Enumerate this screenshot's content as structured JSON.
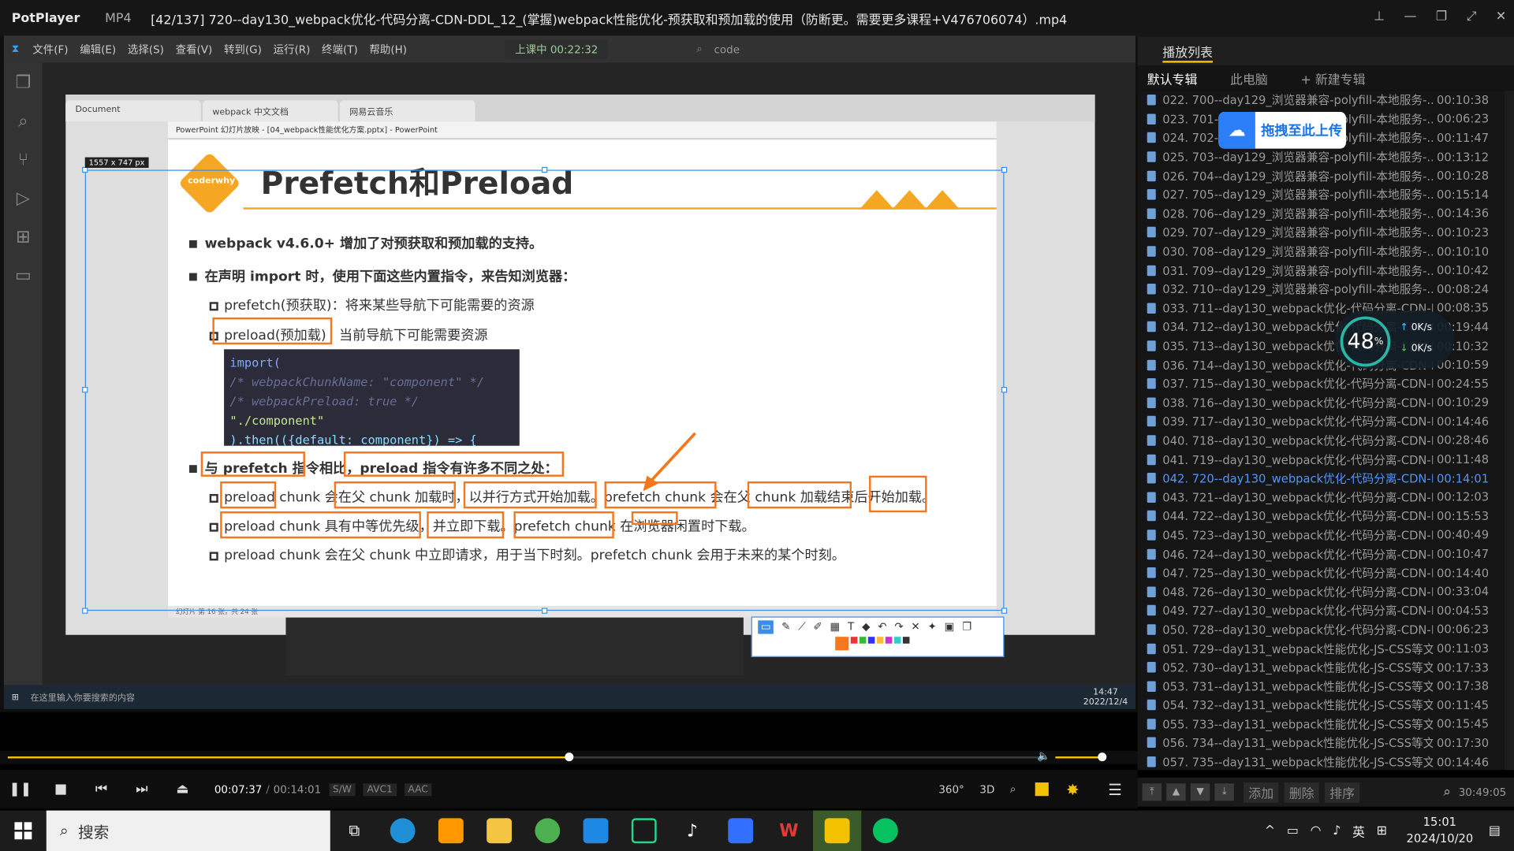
{
  "app": {
    "name": "PotPlayer",
    "format": "MP4",
    "title": "[42/137] 720--day130_webpack优化-代码分离-CDN-DDL_12_(掌握)webpack性能优化-预获取和预加载的使用（防断更。需要更多课程+V476706074）.mp4"
  },
  "video": {
    "vscode_menu": [
      "文件(F)",
      "编辑(E)",
      "选择(S)",
      "查看(V)",
      "转到(G)",
      "运行(R)",
      "终端(T)",
      "帮助(H)"
    ],
    "remote_status": "上课中 00:22:32",
    "search_text": "code",
    "browser_tabs": [
      "Document",
      "webpack 中文文档",
      "网易云音乐"
    ],
    "ppt_title": "PowerPoint 幻灯片放映 - [04_webpack性能优化方案.pptx] - PowerPoint",
    "size_label": "1557 x 747  px",
    "slide_status": "幻灯片 第 16 张，共 24 张",
    "slide": {
      "title": "Prefetch和Preload",
      "logo": "coderwhy",
      "bullet1": "webpack v4.6.0+ 增加了对预获取和预加载的支持。",
      "bullet2": "在声明 import 时，使用下面这些内置指令，来告知浏览器：",
      "sub1": "prefetch(预获取)：将来某些导航下可能需要的资源",
      "sub2_a": "preload(预加载)",
      "sub2_b": "当前导航下可能需要资源",
      "code": [
        "import(",
        "  /* webpackChunkName: \"component\" */",
        "  /* webpackPreload: true */",
        "  \"./component\"",
        ").then(({default: component}) => {"
      ],
      "bullet3_a": "与 prefetch 指令相比，",
      "bullet3_b": "preload 指令有许多不同之处：",
      "d1": "preload chunk 会在父 chunk 加载时，以并行方式开始加载。prefetch chunk 会在父 chunk 加载结束后开始加载。",
      "d2": "preload chunk 具有中等优先级，并立即下载。prefetch chunk 在浏览器闲置时下载。",
      "d3": "preload chunk 会在父 chunk 中立即请求，用于当下时刻。prefetch chunk 会用于未来的某个时刻。"
    },
    "inner_taskbar_search": "在这里输入你要搜索的内容",
    "inner_clock": "14:47",
    "inner_date": "2022/12/4"
  },
  "playlist": {
    "header": "播放列表",
    "tabs": [
      "默认专辑",
      "此电脑",
      "+ 新建专辑"
    ],
    "items": [
      [
        "022. 700--day129_浏览器兼容-polyfill-本地服务-...",
        "00:10:38"
      ],
      [
        "023. 701--day129_浏览器兼容-polyfill-本地服务-...",
        "00:06:23"
      ],
      [
        "024. 702--day129_浏览器兼容-polyfill-本地服务-...",
        "00:11:47"
      ],
      [
        "025. 703--day129_浏览器兼容-polyfill-本地服务-...",
        "00:13:12"
      ],
      [
        "026. 704--day129_浏览器兼容-polyfill-本地服务-...",
        "00:10:28"
      ],
      [
        "027. 705--day129_浏览器兼容-polyfill-本地服务-...",
        "00:15:14"
      ],
      [
        "028. 706--day129_浏览器兼容-polyfill-本地服务-...",
        "00:14:36"
      ],
      [
        "029. 707--day129_浏览器兼容-polyfill-本地服务-...",
        "00:10:23"
      ],
      [
        "030. 708--day129_浏览器兼容-polyfill-本地服务-...",
        "00:10:10"
      ],
      [
        "031. 709--day129_浏览器兼容-polyfill-本地服务-...",
        "00:10:42"
      ],
      [
        "032. 710--day129_浏览器兼容-polyfill-本地服务-...",
        "00:08:24"
      ],
      [
        "033. 711--day130_webpack优化-代码分离-CDN-D...",
        "00:08:35"
      ],
      [
        "034. 712--day130_webpack优化-代码分离-CDN-D...",
        "00:19:44"
      ],
      [
        "035. 713--day130_webpack优化-代码分离-CDN-D...",
        "00:10:32"
      ],
      [
        "036. 714--day130_webpack优化-代码分离-CDN-D...",
        "00:10:59"
      ],
      [
        "037. 715--day130_webpack优化-代码分离-CDN-D...",
        "00:24:55"
      ],
      [
        "038. 716--day130_webpack优化-代码分离-CDN-D...",
        "00:10:29"
      ],
      [
        "039. 717--day130_webpack优化-代码分离-CDN-D...",
        "00:14:46"
      ],
      [
        "040. 718--day130_webpack优化-代码分离-CDN-D...",
        "00:28:46"
      ],
      [
        "041. 719--day130_webpack优化-代码分离-CDN-D...",
        "00:11:48"
      ],
      [
        "042. 720--day130_webpack优化-代码分离-CDN-D...",
        "00:14:01"
      ],
      [
        "043. 721--day130_webpack优化-代码分离-CDN-D...",
        "00:12:03"
      ],
      [
        "044. 722--day130_webpack优化-代码分离-CDN-D...",
        "00:15:53"
      ],
      [
        "045. 723--day130_webpack优化-代码分离-CDN-D...",
        "00:40:49"
      ],
      [
        "046. 724--day130_webpack优化-代码分离-CDN-D...",
        "00:10:47"
      ],
      [
        "047. 725--day130_webpack优化-代码分离-CDN-D...",
        "00:14:40"
      ],
      [
        "048. 726--day130_webpack优化-代码分离-CDN-D...",
        "00:33:04"
      ],
      [
        "049. 727--day130_webpack优化-代码分离-CDN-D...",
        "00:04:53"
      ],
      [
        "050. 728--day130_webpack优化-代码分离-CDN-D...",
        "00:06:23"
      ],
      [
        "051. 729--day131_webpack性能优化-JS-CSS等文...",
        "00:11:03"
      ],
      [
        "052. 730--day131_webpack性能优化-JS-CSS等文...",
        "00:17:33"
      ],
      [
        "053. 731--day131_webpack性能优化-JS-CSS等文...",
        "00:17:38"
      ],
      [
        "054. 732--day131_webpack性能优化-JS-CSS等文...",
        "00:11:45"
      ],
      [
        "055. 733--day131_webpack性能优化-JS-CSS等文...",
        "00:15:45"
      ],
      [
        "056. 734--day131_webpack性能优化-JS-CSS等文...",
        "00:17:30"
      ],
      [
        "057. 735--day131_webpack性能优化-JS-CSS等文...",
        "00:14:46"
      ]
    ],
    "current_index": 20,
    "bottom": {
      "add": "添加",
      "delete": "删除",
      "sort": "排序",
      "total": "30:49:05"
    }
  },
  "upload_overlay": "拖拽至此上传",
  "speed": {
    "percent": "48",
    "unit": "%",
    "up": "0",
    "down": "0",
    "rate_unit": "K/s"
  },
  "player": {
    "time_current": "00:07:37",
    "time_total": "00:14:01",
    "progress": 0.543,
    "volume": 0.8,
    "tags": [
      "S/W",
      "AVC1",
      "AAC"
    ],
    "btn_360": "360°",
    "btn_3d": "3D"
  },
  "taskbar": {
    "search": "搜索",
    "ime": "英",
    "time": "15:01",
    "date": "2024/10/20"
  },
  "colors": {
    "accent": "#f2c200",
    "highlight": "#f5771e",
    "playing": "#4e96ff"
  }
}
